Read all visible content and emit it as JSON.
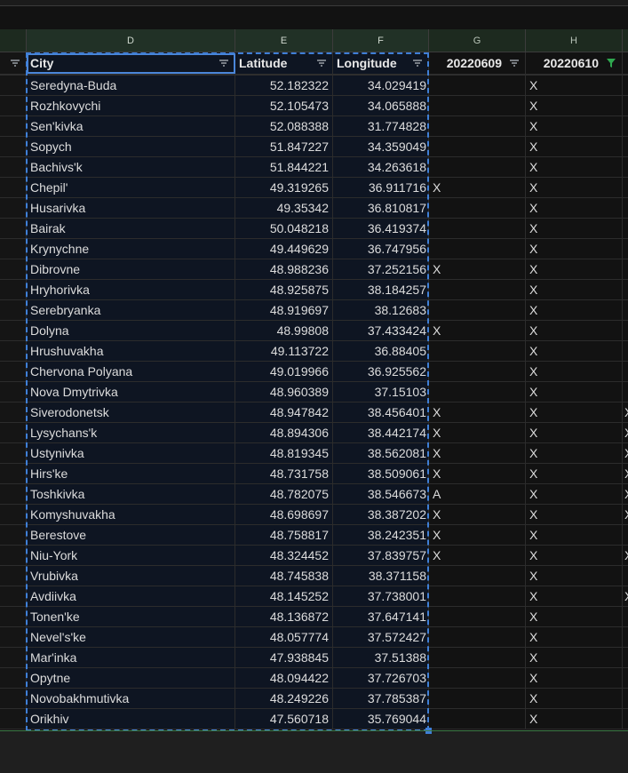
{
  "columns": [
    "D",
    "E",
    "F",
    "G",
    "H"
  ],
  "headers": {
    "city": "City",
    "latitude": "Latitude",
    "longitude": "Longitude",
    "date1": "20220609",
    "date2": "20220610"
  },
  "rows": [
    {
      "city": "Seredyna-Buda",
      "lat": "52.182322",
      "lon": "34.029419",
      "g": "",
      "h": "X",
      "i": ""
    },
    {
      "city": "Rozhkovychi",
      "lat": "52.105473",
      "lon": "34.065888",
      "g": "",
      "h": "X",
      "i": ""
    },
    {
      "city": "Sen'kivka",
      "lat": "52.088388",
      "lon": "31.774828",
      "g": "",
      "h": "X",
      "i": ""
    },
    {
      "city": "Sopych",
      "lat": "51.847227",
      "lon": "34.359049",
      "g": "",
      "h": "X",
      "i": ""
    },
    {
      "city": "Bachivs'k",
      "lat": "51.844221",
      "lon": "34.263618",
      "g": "",
      "h": "X",
      "i": ""
    },
    {
      "city": "Chepil'",
      "lat": "49.319265",
      "lon": "36.911716",
      "g": "X",
      "h": "X",
      "i": ""
    },
    {
      "city": "Husarivka",
      "lat": "49.35342",
      "lon": "36.810817",
      "g": "",
      "h": "X",
      "i": ""
    },
    {
      "city": "Bairak",
      "lat": "50.048218",
      "lon": "36.419374",
      "g": "",
      "h": "X",
      "i": ""
    },
    {
      "city": "Krynychne",
      "lat": "49.449629",
      "lon": "36.747956",
      "g": "",
      "h": "X",
      "i": ""
    },
    {
      "city": "Dibrovne",
      "lat": "48.988236",
      "lon": "37.252156",
      "g": "X",
      "h": "X",
      "i": ""
    },
    {
      "city": "Hryhorivka",
      "lat": "48.925875",
      "lon": "38.184257",
      "g": "",
      "h": "X",
      "i": ""
    },
    {
      "city": "Serebryanka",
      "lat": "48.919697",
      "lon": "38.12683",
      "g": "",
      "h": "X",
      "i": ""
    },
    {
      "city": "Dolyna",
      "lat": "48.99808",
      "lon": "37.433424",
      "g": "X",
      "h": "X",
      "i": ""
    },
    {
      "city": "Hrushuvakha",
      "lat": "49.113722",
      "lon": "36.88405",
      "g": "",
      "h": "X",
      "i": ""
    },
    {
      "city": "Chervona Polyana",
      "lat": "49.019966",
      "lon": "36.925562",
      "g": "",
      "h": "X",
      "i": ""
    },
    {
      "city": "Nova Dmytrivka",
      "lat": "48.960389",
      "lon": "37.15103",
      "g": "",
      "h": "X",
      "i": ""
    },
    {
      "city": "Siverodonetsk",
      "lat": "48.947842",
      "lon": "38.456401",
      "g": "X",
      "h": "X",
      "i": "X"
    },
    {
      "city": "Lysychans'k",
      "lat": "48.894306",
      "lon": "38.442174",
      "g": "X",
      "h": "X",
      "i": "X"
    },
    {
      "city": "Ustynivka",
      "lat": "48.819345",
      "lon": "38.562081",
      "g": "X",
      "h": "X",
      "i": "X"
    },
    {
      "city": "Hirs'ke",
      "lat": "48.731758",
      "lon": "38.509061",
      "g": "X",
      "h": "X",
      "i": "X"
    },
    {
      "city": "Toshkivka",
      "lat": "48.782075",
      "lon": "38.546673",
      "g": "A",
      "h": "X",
      "i": "X"
    },
    {
      "city": "Komyshuvakha",
      "lat": "48.698697",
      "lon": "38.387202",
      "g": "X",
      "h": "X",
      "i": "X"
    },
    {
      "city": "Berestove",
      "lat": "48.758817",
      "lon": "38.242351",
      "g": "X",
      "h": "X",
      "i": ""
    },
    {
      "city": "Niu-York",
      "lat": "48.324452",
      "lon": "37.839757",
      "g": "X",
      "h": "X",
      "i": "X"
    },
    {
      "city": "Vrubivka",
      "lat": "48.745838",
      "lon": "38.371158",
      "g": "",
      "h": "X",
      "i": ""
    },
    {
      "city": "Avdiivka",
      "lat": "48.145252",
      "lon": "37.738001",
      "g": "",
      "h": "X",
      "i": "X"
    },
    {
      "city": "Tonen'ke",
      "lat": "48.136872",
      "lon": "37.647141",
      "g": "",
      "h": "X",
      "i": ""
    },
    {
      "city": "Nevel's'ke",
      "lat": "48.057774",
      "lon": "37.572427",
      "g": "",
      "h": "X",
      "i": ""
    },
    {
      "city": "Mar'inka",
      "lat": "47.938845",
      "lon": "37.51388",
      "g": "",
      "h": "X",
      "i": ""
    },
    {
      "city": "Opytne",
      "lat": "48.094422",
      "lon": "37.726703",
      "g": "",
      "h": "X",
      "i": ""
    },
    {
      "city": "Novobakhmutivka",
      "lat": "48.249226",
      "lon": "37.785387",
      "g": "",
      "h": "X",
      "i": ""
    },
    {
      "city": "Orikhiv",
      "lat": "47.560718",
      "lon": "35.769044",
      "g": "",
      "h": "X",
      "i": ""
    }
  ],
  "icons": {
    "filter": "filter-icon",
    "filter_active": "filter-active-icon"
  },
  "colors": {
    "accent": "#3f7fd6",
    "filter_active": "#2fa84f"
  }
}
